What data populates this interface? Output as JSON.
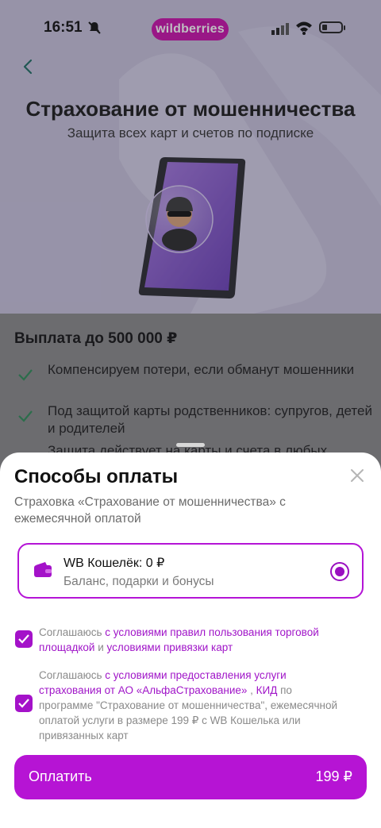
{
  "status_bar": {
    "time": "16:51",
    "brand": "wildberries"
  },
  "hero": {
    "title": "Страхование от мошенничества",
    "subtitle": "Защита всех карт и счетов по подписке"
  },
  "benefits": {
    "heading": "Выплата до 500 000 ₽",
    "items": [
      "Компенсируем потери, если обманут мошенники",
      "Под защитой карты родственников: супругов, детей и родителей",
      "Защита действует на карты и счета в любых"
    ]
  },
  "payment_sheet": {
    "title": "Способы оплаты",
    "description": "Страховка «Страхование от мошенничества» с ежемесячной оплатой",
    "wallet": {
      "name": "WB Кошелёк: 0 ₽",
      "subtitle": "Баланс, подарки и бонусы",
      "selected": true
    },
    "agreement1": {
      "prefix": "Соглашаюсь ",
      "link1": "с условиями правил пользования торговой площадкой",
      "mid": " и ",
      "link2": "условиями привязки карт",
      "checked": true
    },
    "agreement2": {
      "prefix": "Соглашаюсь ",
      "link1": "с условиями предоставления услуги страхования от АО «АльфаСтрахование»",
      "sep": " , ",
      "link2": "КИД",
      "suffix": " по программе \"Страхование от мошенничества\", ежемесячной оплатой услуги в размере 199 ₽ с WB Кошелька или привязанных карт",
      "checked": true
    },
    "pay_button": {
      "label": "Оплатить",
      "amount": "199 ₽"
    }
  },
  "colors": {
    "accent": "#b614d4",
    "brand": "#cb11ab",
    "check": "#2e8b57"
  }
}
